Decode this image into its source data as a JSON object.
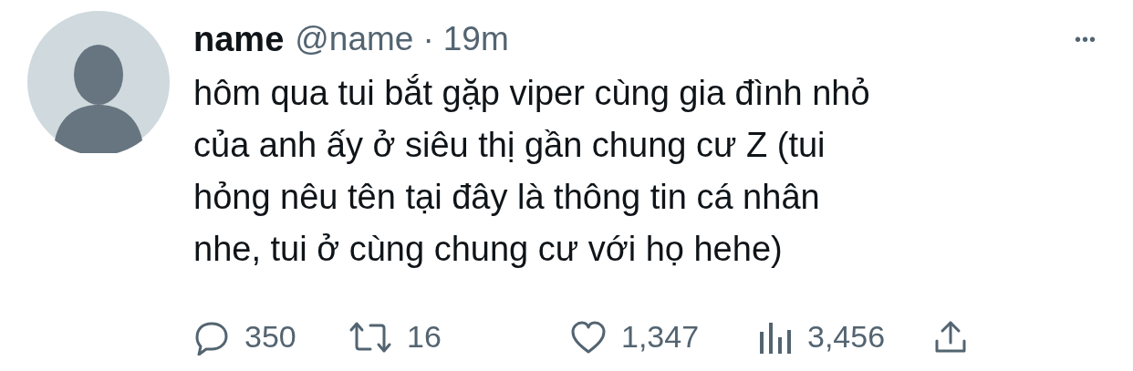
{
  "author": {
    "name": "name",
    "handle": "@name",
    "separator": "·",
    "time": "19m",
    "avatar": {
      "kind": "silhouette"
    }
  },
  "more": "•••",
  "text": "hôm qua tui bắt gặp viper cùng gia đình nhỏ\ncủa anh ấy ở siêu thị gần chung cư Z (tui\nhỏng nêu tên tại đây là thông tin cá nhân\nnhe, tui ở cùng chung cư với họ hehe)",
  "actions": [
    {
      "kind": "reply",
      "count": "350"
    },
    {
      "kind": "retweet",
      "count": "16"
    },
    {
      "kind": "like",
      "count": "1,347"
    },
    {
      "kind": "views",
      "count": "3,456"
    },
    {
      "kind": "share"
    }
  ]
}
